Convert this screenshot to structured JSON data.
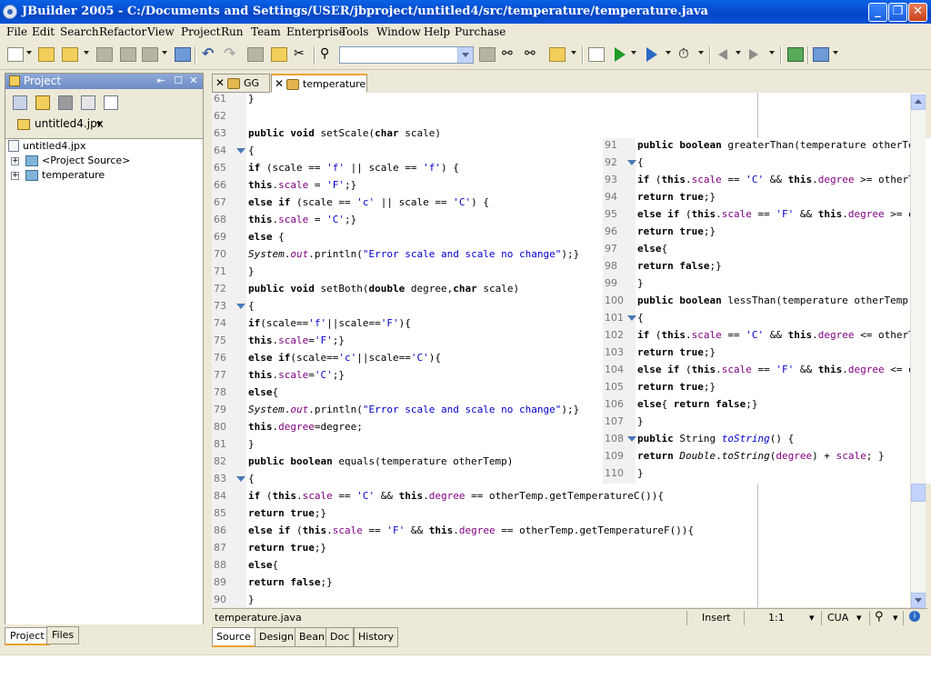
{
  "window": {
    "title": "JBuilder 2005 - C:/Documents and Settings/USER/jbproject/untitled4/src/temperature/temperature.java"
  },
  "menu": [
    "File",
    "Edit",
    "Search",
    "Refactor",
    "View",
    "Project",
    "Run",
    "Team",
    "Enterprise",
    "Tools",
    "Window",
    "Help",
    "Purchase"
  ],
  "project_panel": {
    "title": "Project",
    "file_selector": "untitled4.jpx",
    "tree": [
      {
        "label": "untitled4.jpx"
      },
      {
        "label": "<Project Source>"
      },
      {
        "label": "temperature"
      }
    ],
    "bottom_tabs": [
      "Project",
      "Files"
    ]
  },
  "editor": {
    "tabs": [
      {
        "label": "GG"
      },
      {
        "label": "temperature"
      }
    ],
    "lines": [
      {
        "n": "61",
        "html": "}"
      },
      {
        "n": "62",
        "html": ""
      },
      {
        "n": "63",
        "html": "<span class=\"kw\">public</span> <span class=\"kw\">void</span> setScale(<span class=\"kw\">char</span> scale)"
      },
      {
        "n": "64",
        "html": "{",
        "fold": true
      },
      {
        "n": "65",
        "html": "<span class=\"kw\">if</span> (scale == <span class=\"str\">'f'</span> || scale == <span class=\"str\">'f'</span>) {"
      },
      {
        "n": "66",
        "html": "<span class=\"kw\">this</span>.<span class=\"fld\">scale</span> = <span class=\"str\">'F'</span>;}"
      },
      {
        "n": "67",
        "html": "<span class=\"kw\">else</span> <span class=\"kw\">if</span> (scale == <span class=\"str\">'c'</span> || scale == <span class=\"str\">'C'</span>) {"
      },
      {
        "n": "68",
        "html": "<span class=\"kw\">this</span>.<span class=\"fld\">scale</span> = <span class=\"str\">'C'</span>;}"
      },
      {
        "n": "69",
        "html": "<span class=\"kw\">else</span> {"
      },
      {
        "n": "70",
        "html": "<span class=\"it\">System</span>.<span class=\"it fld\">out</span>.println(<span class=\"str\">\"Error scale and scale no change\"</span>);}"
      },
      {
        "n": "71",
        "html": "}"
      },
      {
        "n": "72",
        "html": "<span class=\"kw\">public</span> <span class=\"kw\">void</span> setBoth(<span class=\"kw\">double</span> degree,<span class=\"kw\">char</span> scale)"
      },
      {
        "n": "73",
        "html": "{",
        "fold": true
      },
      {
        "n": "74",
        "html": "<span class=\"kw\">if</span>(scale==<span class=\"str\">'f'</span>||scale==<span class=\"str\">'F'</span>){"
      },
      {
        "n": "75",
        "html": "<span class=\"kw\">this</span>.<span class=\"fld\">scale</span>=<span class=\"str\">'F'</span>;}"
      },
      {
        "n": "76",
        "html": "<span class=\"kw\">else</span> <span class=\"kw\">if</span>(scale==<span class=\"str\">'c'</span>||scale==<span class=\"str\">'C'</span>){"
      },
      {
        "n": "77",
        "html": "<span class=\"kw\">this</span>.<span class=\"fld\">scale</span>=<span class=\"str\">'C'</span>;}"
      },
      {
        "n": "78",
        "html": "<span class=\"kw\">else</span>{"
      },
      {
        "n": "79",
        "html": "<span class=\"it\">System</span>.<span class=\"it fld\">out</span>.println(<span class=\"str\">\"Error scale and scale no change\"</span>);}"
      },
      {
        "n": "80",
        "html": "<span class=\"kw\">this</span>.<span class=\"fld\">degree</span>=degree;"
      },
      {
        "n": "81",
        "html": "}"
      },
      {
        "n": "82",
        "html": "<span class=\"kw\">public</span> <span class=\"kw\">boolean</span> equals(temperature otherTemp)"
      },
      {
        "n": "83",
        "html": "{",
        "fold": true
      },
      {
        "n": "84",
        "html": "<span class=\"kw\">if</span> (<span class=\"kw\">this</span>.<span class=\"fld\">scale</span> == <span class=\"str\">'C'</span> &amp;&amp; <span class=\"kw\">this</span>.<span class=\"fld\">degree</span> == otherTemp.getTemperatureC()){"
      },
      {
        "n": "85",
        "html": "<span class=\"kw\">return</span> <span class=\"kw\">true</span>;}"
      },
      {
        "n": "86",
        "html": "<span class=\"kw\">else</span> <span class=\"kw\">if</span> (<span class=\"kw\">this</span>.<span class=\"fld\">scale</span> == <span class=\"str\">'F'</span> &amp;&amp; <span class=\"kw\">this</span>.<span class=\"fld\">degree</span> == otherTemp.getTemperatureF()){"
      },
      {
        "n": "87",
        "html": "<span class=\"kw\">return</span> <span class=\"kw\">true</span>;}"
      },
      {
        "n": "88",
        "html": "<span class=\"kw\">else</span>{"
      },
      {
        "n": "89",
        "html": "<span class=\"kw\">return</span> <span class=\"kw\">false</span>;}"
      },
      {
        "n": "90",
        "html": "}"
      }
    ],
    "overlay_lines": [
      {
        "n": "91",
        "html": "<span class=\"kw\">public</span> <span class=\"kw\">boolean</span> greaterThan(temperature otherTe"
      },
      {
        "n": "92",
        "html": "{",
        "fold": true
      },
      {
        "n": "93",
        "html": "<span class=\"kw\">if</span> (<span class=\"kw\">this</span>.<span class=\"fld\">scale</span> == <span class=\"str\">'C'</span> &amp;&amp; <span class=\"kw\">this</span>.<span class=\"fld\">degree</span> &gt;= otherT"
      },
      {
        "n": "94",
        "html": "<span class=\"kw\">return</span> <span class=\"kw\">true</span>;}"
      },
      {
        "n": "95",
        "html": "<span class=\"kw\">else</span> <span class=\"kw\">if</span> (<span class=\"kw\">this</span>.<span class=\"fld\">scale</span> == <span class=\"str\">'F'</span> &amp;&amp; <span class=\"kw\">this</span>.<span class=\"fld\">degree</span> &gt;= o"
      },
      {
        "n": "96",
        "html": "<span class=\"kw\">return</span> <span class=\"kw\">true</span>;}"
      },
      {
        "n": "97",
        "html": "<span class=\"kw\">else</span>{"
      },
      {
        "n": "98",
        "html": "<span class=\"kw\">return</span> <span class=\"kw\">false</span>;}"
      },
      {
        "n": "99",
        "html": "}"
      },
      {
        "n": "100",
        "html": "<span class=\"kw\">public</span> <span class=\"kw\">boolean</span> lessThan(temperature otherTemp)"
      },
      {
        "n": "101",
        "html": "{",
        "fold": true
      },
      {
        "n": "102",
        "html": "<span class=\"kw\">if</span> (<span class=\"kw\">this</span>.<span class=\"fld\">scale</span> == <span class=\"str\">'C'</span> &amp;&amp; <span class=\"kw\">this</span>.<span class=\"fld\">degree</span> &lt;= otherT"
      },
      {
        "n": "103",
        "html": "<span class=\"kw\">return</span> <span class=\"kw\">true</span>;}"
      },
      {
        "n": "104",
        "html": "<span class=\"kw\">else</span> <span class=\"kw\">if</span> (<span class=\"kw\">this</span>.<span class=\"fld\">scale</span> == <span class=\"str\">'F'</span> &amp;&amp; <span class=\"kw\">this</span>.<span class=\"fld\">degree</span> &lt;= o"
      },
      {
        "n": "105",
        "html": "<span class=\"kw\">return</span> <span class=\"kw\">true</span>;}"
      },
      {
        "n": "106",
        "html": "<span class=\"kw\">else</span>{ <span class=\"kw\">return</span> <span class=\"kw\">false</span>;}"
      },
      {
        "n": "107",
        "html": "}"
      },
      {
        "n": "108",
        "html": "<span class=\"kw\">public</span> String <span class=\"it str\">toString</span>() {",
        "fold": true
      },
      {
        "n": "109",
        "html": "<span class=\"kw\">return</span> <span class=\"it\">Double</span>.<span class=\"it\">toString</span>(<span class=\"fld\">degree</span>) + <span class=\"fld\">scale</span>; }"
      },
      {
        "n": "110",
        "html": "}"
      }
    ],
    "bottom_tabs": [
      "Source",
      "Design",
      "Bean",
      "Doc",
      "History"
    ]
  },
  "status": {
    "file": "temperature.java",
    "mode": "Insert",
    "position": "1:1",
    "keymap": "CUA"
  },
  "colors": {
    "title_bar": "#0346c4",
    "keyword": "#000000",
    "field": "#800080",
    "string": "#0000cc",
    "tab_accent": "#f0a030"
  },
  "icons": [
    "new-icon",
    "open-icon",
    "save-icon",
    "print-icon",
    "undo-icon",
    "redo-icon",
    "copy-icon",
    "paste-icon",
    "cut-icon",
    "find-icon",
    "run-icon",
    "debug-icon",
    "back-icon",
    "forward-icon"
  ]
}
